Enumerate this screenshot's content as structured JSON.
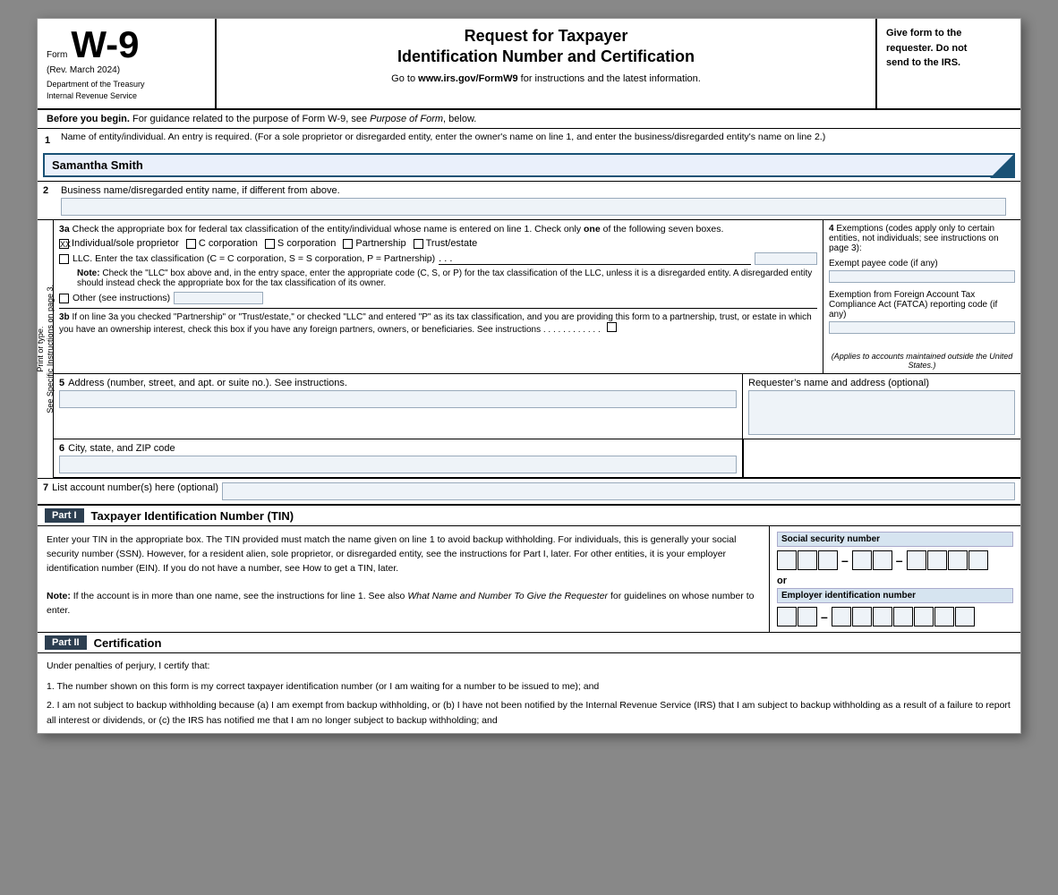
{
  "header": {
    "form_label": "Form",
    "form_number": "W-9",
    "rev_date": "(Rev. March 2024)",
    "dept_line1": "Department of the Treasury",
    "dept_line2": "Internal Revenue Service",
    "title_line1": "Request for Taxpayer",
    "title_line2": "Identification Number and Certification",
    "url_text": "Go to www.irs.gov/FormW9 for instructions and the latest information.",
    "right_text_line1": "Give form to the",
    "right_text_line2": "requester. Do not",
    "right_text_line3": "send to the IRS."
  },
  "before_begin": "Before you begin. For guidance related to the purpose of Form W-9, see Purpose of Form, below.",
  "line1": {
    "number": "1",
    "label": "Name of entity/individual. An entry is required. (For a sole proprietor or disregarded entity, enter the owner's name on line 1, and enter the business/disregarded entity's name on line 2.)",
    "value": "Samantha Smith"
  },
  "line2": {
    "number": "2",
    "label": "Business name/disregarded entity name, if different from above."
  },
  "side_label": "Print or type.\nSee Specific Instructions on page 3.",
  "line3a": {
    "label": "3a Check the appropriate box for federal tax classification of the entity/individual whose name is entered on line 1. Check only one of the following seven boxes.",
    "options": [
      {
        "id": "individual",
        "label": "Individual/sole proprietor",
        "checked": true
      },
      {
        "id": "c_corp",
        "label": "C corporation",
        "checked": false
      },
      {
        "id": "s_corp",
        "label": "S corporation",
        "checked": false
      },
      {
        "id": "partnership",
        "label": "Partnership",
        "checked": false
      },
      {
        "id": "trust",
        "label": "Trust/estate",
        "checked": false
      }
    ],
    "llc_label": "LLC. Enter the tax classification (C = C corporation, S = S corporation, P = Partnership)",
    "llc_note": "Note: Check the “LLC” box above and, in the entry space, enter the appropriate code (C, S, or P) for the tax classification of the LLC, unless it is a disregarded entity. A disregarded entity should instead check the appropriate box for the tax classification of its owner.",
    "other_label": "Other (see instructions)"
  },
  "line3b": {
    "label": "3b If on line 3a you checked “Partnership” or “Trust/estate,” or checked “LLC” and entered “P” as its tax classification, and you are providing this form to a partnership, trust, or estate in which you have an ownership interest, check this box if you have any foreign partners, owners, or beneficiaries. See instructions",
    "italic_text": "(Applies to accounts maintained outside the United States.)"
  },
  "line4": {
    "label": "4 Exemptions (codes apply only to certain entities, not individuals; see instructions on page 3):",
    "exempt_payee_label": "Exempt payee code (if any)",
    "fatca_label": "Exemption from Foreign Account Tax Compliance Act (FATCA) reporting code (if any)"
  },
  "line5": {
    "number": "5",
    "label": "Address (number, street, and apt. or suite no.). See instructions.",
    "requester_label": "Requester’s name and address (optional)"
  },
  "line6": {
    "number": "6",
    "label": "City, state, and ZIP code"
  },
  "line7": {
    "number": "7",
    "label": "List account number(s) here (optional)"
  },
  "part1": {
    "badge": "Part I",
    "title": "Taxpayer Identification Number (TIN)",
    "description": "Enter your TIN in the appropriate box. The TIN provided must match the name given on line 1 to avoid backup withholding. For individuals, this is generally your social security number (SSN). However, for a resident alien, sole proprietor, or disregarded entity, see the instructions for Part I, later. For other entities, it is your employer identification number (EIN). If you do not have a number, see How to get a TIN, later.",
    "note": "Note: If the account is in more than one name, see the instructions for line 1. See also What Name and Number To Give the Requester for guidelines on whose number to enter.",
    "ssn_label": "Social security number",
    "or_text": "or",
    "ein_label": "Employer identification number"
  },
  "part2": {
    "badge": "Part II",
    "title": "Certification",
    "intro": "Under penalties of perjury, I certify that:",
    "items": [
      "1. The number shown on this form is my correct taxpayer identification number (or I am waiting for a number to be issued to me); and",
      "2. I am not subject to backup withholding because (a) I am exempt from backup withholding, or (b) I have not been notified by the Internal Revenue Service (IRS) that I am subject to backup withholding as a result of a failure to report all interest or dividends, or (c) the IRS has notified me that I am no longer subject to backup withholding; and"
    ]
  }
}
